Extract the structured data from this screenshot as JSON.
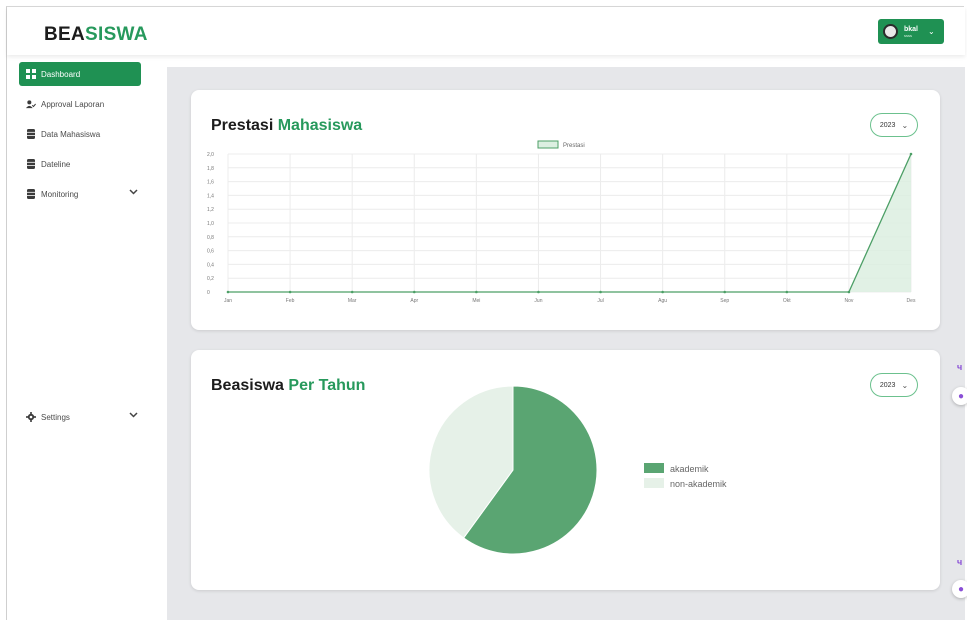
{
  "brand": {
    "part1": "BEA",
    "part2": "SISWA"
  },
  "user": {
    "name": "bkal",
    "role": "ssss",
    "avatar_icon": "user-avatar"
  },
  "sidebar": {
    "items": [
      {
        "label": "Dashboard",
        "icon": "grid-icon",
        "active": true
      },
      {
        "label": "Approval Laporan",
        "icon": "user-check-icon"
      },
      {
        "label": "Data Mahasiswa",
        "icon": "database-icon"
      },
      {
        "label": "Dateline",
        "icon": "database-icon"
      },
      {
        "label": "Monitoring",
        "icon": "database-icon",
        "has_chevron": true
      },
      {
        "label": "Settings",
        "icon": "gear-icon",
        "has_chevron": true
      }
    ]
  },
  "cards": {
    "prestasi": {
      "title_a": "Prestasi",
      "title_b": "Mahasiswa",
      "year": "2023"
    },
    "beasiswa": {
      "title_a": "Beasiswa",
      "title_b": "Per Tahun",
      "year": "2023"
    }
  },
  "colors": {
    "accent": "#1f9153",
    "brand": "#27995c",
    "pie_dark": "#5aa572",
    "pie_light": "#e6f1e8"
  },
  "chart_data": [
    {
      "type": "area",
      "title": "",
      "categories": [
        "Jan",
        "Feb",
        "Mar",
        "Apr",
        "Mei",
        "Jun",
        "Jul",
        "Agu",
        "Sep",
        "Okt",
        "Nov",
        "Des"
      ],
      "series": [
        {
          "name": "Prestasi",
          "values": [
            0,
            0,
            0,
            0,
            0,
            0,
            0,
            0,
            0,
            0,
            0,
            2
          ]
        }
      ],
      "yticks": [
        "2,0",
        "1,8",
        "1,6",
        "1,4",
        "1,2",
        "1,0",
        "0,8",
        "0,6",
        "0,4",
        "0,2",
        "0"
      ],
      "ylim": [
        0,
        2
      ],
      "grid": true,
      "legend": "top-center"
    },
    {
      "type": "pie",
      "title": "",
      "labels": [
        "akademik",
        "non-akademik"
      ],
      "values": [
        60,
        40
      ],
      "legend": "right"
    }
  ]
}
